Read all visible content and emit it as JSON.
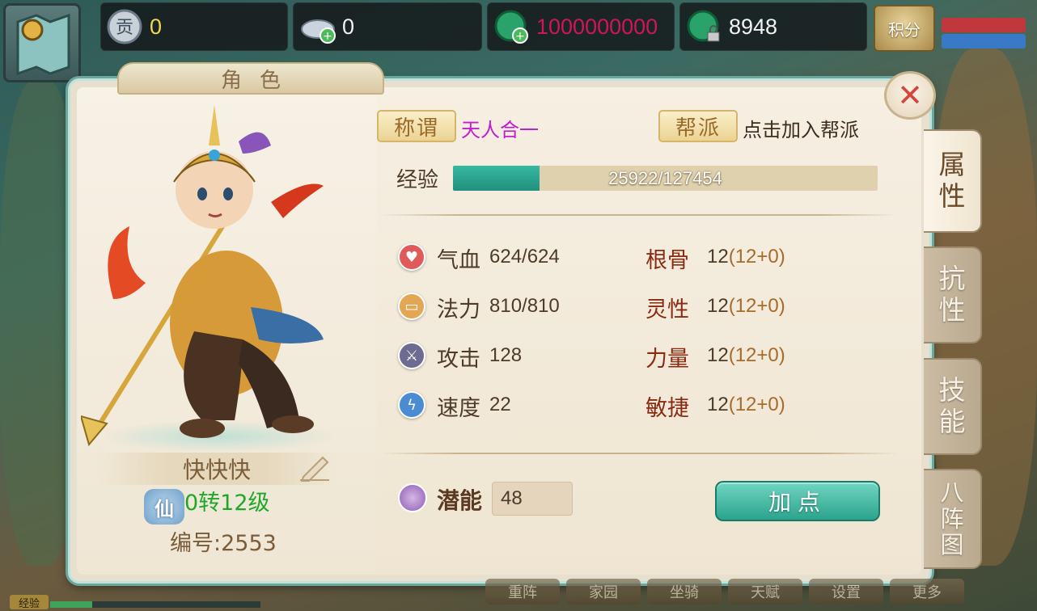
{
  "currency": {
    "contribution": {
      "icon": "contribution-coin-icon",
      "value": "0"
    },
    "silver": {
      "icon": "silver-ingot-icon",
      "value": "0"
    },
    "jade": {
      "icon": "jade-add-icon",
      "value": "1000000000",
      "color": "#d0155c"
    },
    "locked_jade": {
      "icon": "jade-locked-icon",
      "value": "8948"
    },
    "score_button": "积分"
  },
  "panel": {
    "title": "角色",
    "close_icon": "close-icon"
  },
  "side_tabs": [
    {
      "label": "属\n性",
      "active": true
    },
    {
      "label": "抗\n性",
      "active": false
    },
    {
      "label": "技\n能",
      "active": false
    },
    {
      "label": "八\n阵\n图",
      "active": false
    }
  ],
  "character": {
    "name": "快快快",
    "realm_badge": "仙",
    "level": "0转12级",
    "id_text": "编号:2553"
  },
  "title_info": {
    "title_label": "称谓",
    "title_value": "天人合一",
    "title_color": "#c01fd0",
    "guild_label": "帮派",
    "guild_value": "点击加入帮派"
  },
  "experience": {
    "label": "经验",
    "current": 25922,
    "max": 127454,
    "text": "25922/127454"
  },
  "stats": [
    {
      "name": "气血",
      "value": "624/624",
      "icon": "hp-heart-icon",
      "color": "#e05a5a"
    },
    {
      "name": "法力",
      "value": "810/810",
      "icon": "mana-scroll-icon",
      "color": "#e3a652"
    },
    {
      "name": "攻击",
      "value": "128",
      "icon": "attack-sword-icon",
      "color": "#6d6b8f"
    },
    {
      "name": "速度",
      "value": "22",
      "icon": "speed-lightning-icon",
      "color": "#4b8bd1"
    }
  ],
  "attributes": [
    {
      "name": "根骨",
      "base": "12",
      "detail": "(12+0)"
    },
    {
      "name": "灵性",
      "base": "12",
      "detail": "(12+0)"
    },
    {
      "name": "力量",
      "base": "12",
      "detail": "(12+0)"
    },
    {
      "name": "敏捷",
      "base": "12",
      "detail": "(12+0)"
    }
  ],
  "potential": {
    "label": "潜能",
    "value": "48",
    "button": "加点"
  },
  "bottom_bar": [
    "重阵",
    "家园",
    "坐骑",
    "天赋",
    "设置",
    "更多"
  ],
  "exp_mini": {
    "label": "经验",
    "fraction": 0.2
  }
}
